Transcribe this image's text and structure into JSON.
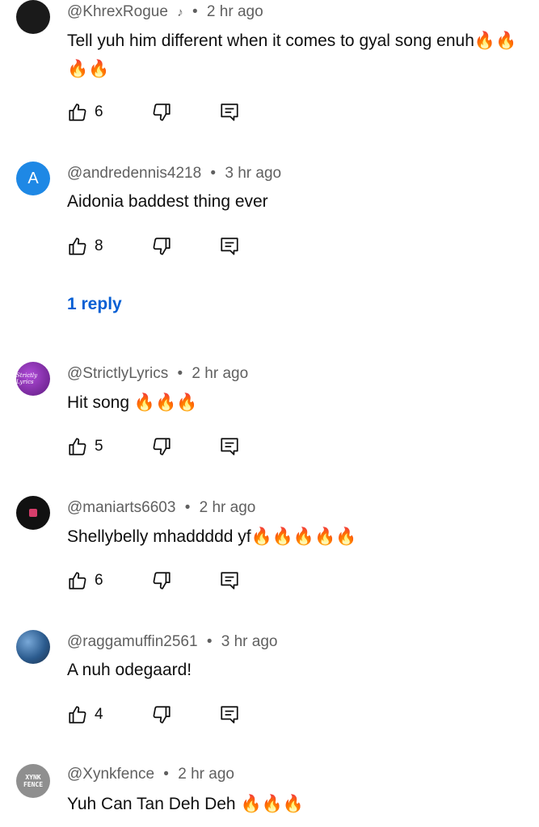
{
  "comments": [
    {
      "author": "@KhrexRogue",
      "time": "2 hr ago",
      "text": "Tell yuh him different when it comes to gyal song enuh",
      "emoji": "🔥🔥🔥🔥",
      "likes": "6",
      "avatar_type": "dark",
      "has_note": true
    },
    {
      "author": "@andredennis4218",
      "time": "3 hr ago",
      "text": "Aidonia baddest thing ever",
      "emoji": "",
      "likes": "8",
      "avatar_type": "letter",
      "avatar_letter": "A",
      "replies": "1 reply"
    },
    {
      "author": "@StrictlyLyrics",
      "time": "2 hr ago",
      "text": "Hit song",
      "emoji": "🔥🔥🔥",
      "likes": "5",
      "avatar_type": "purple",
      "avatar_text": "Strictly Lyrics"
    },
    {
      "author": "@maniarts6603",
      "time": "2 hr ago",
      "text": "Shellybelly mhaddddd yf",
      "emoji": "🔥🔥🔥🔥🔥",
      "likes": "6",
      "avatar_type": "black"
    },
    {
      "author": "@raggamuffin2561",
      "time": "3 hr ago",
      "text": "A nuh odegaard!",
      "emoji": "",
      "likes": "4",
      "avatar_type": "photo"
    },
    {
      "author": "@Xynkfence",
      "time": "2 hr ago",
      "text": "Yuh Can Tan Deh Deh",
      "emoji": "🔥🔥🔥",
      "likes": "",
      "avatar_type": "gray",
      "avatar_text_1": "XYNK",
      "avatar_text_2": "FENCE"
    }
  ],
  "separator": "•",
  "colors": {
    "meta": "#606060",
    "text": "#0f0f0f",
    "link": "#065fd4",
    "fire": "#ff6a00"
  },
  "icons": {
    "like": "thumbs-up-icon",
    "dislike": "thumbs-down-icon",
    "reply": "reply-comment-icon",
    "note": "music-note-icon"
  }
}
